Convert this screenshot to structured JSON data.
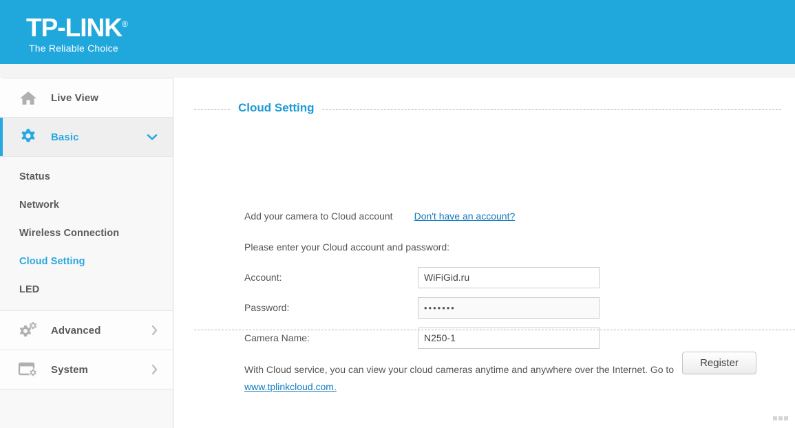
{
  "brand": {
    "name": "TP-LINK",
    "registered_mark": "®",
    "tagline": "The Reliable Choice",
    "header_color": "#20a8dd"
  },
  "accent_color": "#29a8e0",
  "link_color": "#1178bb",
  "sidebar": {
    "items": [
      {
        "label": "Live View",
        "icon": "home-icon",
        "state": "normal",
        "chevron": "none"
      },
      {
        "label": "Basic",
        "icon": "gear-icon",
        "state": "active",
        "chevron": "chevron-down-icon"
      },
      {
        "label": "Advanced",
        "icon": "double-gear-icon",
        "state": "normal",
        "chevron": "chevron-right-icon"
      },
      {
        "label": "System",
        "icon": "window-gear-icon",
        "state": "normal",
        "chevron": "chevron-right-icon"
      }
    ],
    "submenu": [
      {
        "label": "Status",
        "state": "normal"
      },
      {
        "label": "Network",
        "state": "normal"
      },
      {
        "label": "Wireless Connection",
        "state": "normal"
      },
      {
        "label": "Cloud Setting",
        "state": "active"
      },
      {
        "label": "LED",
        "state": "normal"
      }
    ]
  },
  "main": {
    "section_title": "Cloud Setting",
    "intro_text": "Add your camera to Cloud account",
    "no_account_link": "Don't have an account?",
    "prompt": "Please enter your Cloud account and password:",
    "fields": [
      {
        "label": "Account:",
        "value": "WiFiGid.ru",
        "type": "text",
        "shaded": false
      },
      {
        "label": "Password:",
        "value": "•••••••",
        "type": "password",
        "shaded": true
      },
      {
        "label": "Camera Name:",
        "value": "N250-1",
        "type": "text",
        "shaded": false
      }
    ],
    "description_text": "With Cloud service, you can view your cloud cameras anytime and anywhere over the Internet. Go to ",
    "cloud_link": "www.tplinkcloud.com.",
    "register_button": "Register"
  }
}
